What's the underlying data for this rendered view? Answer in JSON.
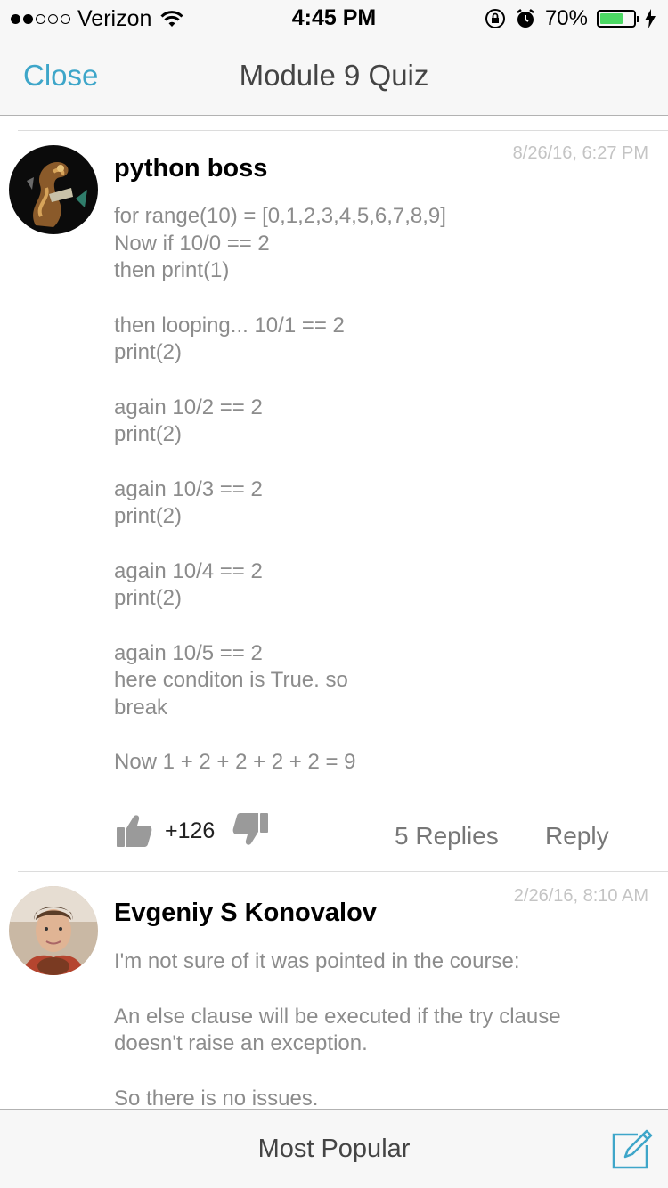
{
  "status_bar": {
    "carrier": "Verizon",
    "time": "4:45 PM",
    "battery_percent": "70%",
    "battery_level": 0.7,
    "signal_bars_filled": 2,
    "signal_bars_total": 5
  },
  "nav": {
    "close_label": "Close",
    "title": "Module 9 Quiz"
  },
  "colors": {
    "accent": "#3ea6c9",
    "battery": "#4cd964"
  },
  "comments": [
    {
      "author": "python boss",
      "timestamp": "8/26/16, 6:27 PM",
      "body": [
        "for range(10) = [0,1,2,3,4,5,6,7,8,9]\nNow if 10/0 == 2\nthen print(1)",
        "then looping... 10/1 == 2\nprint(2)",
        "again 10/2 == 2\nprint(2)",
        "again 10/3 == 2\nprint(2)",
        "again 10/4 == 2\nprint(2)",
        "again 10/5 == 2\nhere conditon is True. so\nbreak",
        "Now 1 + 2 + 2 + 2 + 2 = 9"
      ],
      "votes": "+126",
      "replies_label": "5 Replies",
      "reply_label": "Reply"
    },
    {
      "author": "Evgeniy S Konovalov",
      "timestamp": "2/26/16, 8:10 AM",
      "body": [
        "I'm not sure of it was pointed in the course:",
        "An else clause will be executed if the try clause\ndoesn't raise an exception.",
        "So there is no issues."
      ]
    }
  ],
  "bottom_bar": {
    "sort_label": "Most Popular"
  }
}
